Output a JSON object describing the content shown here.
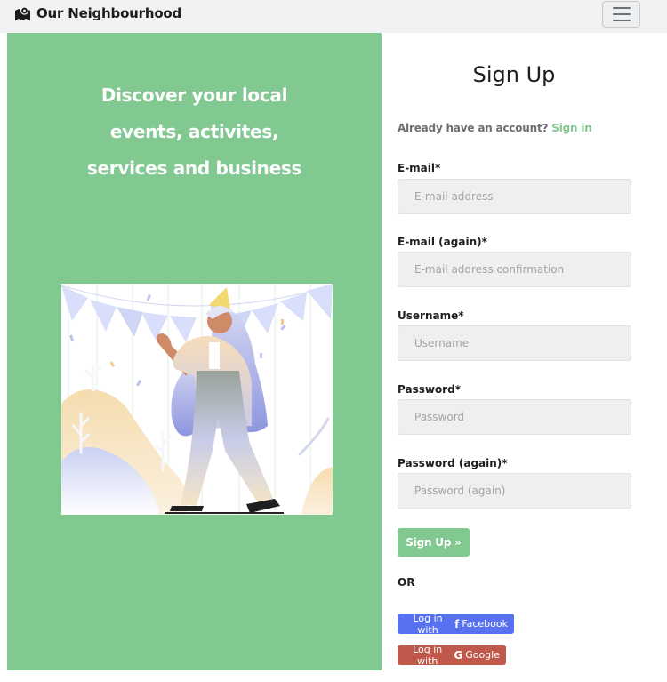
{
  "navbar": {
    "brand_icon": "map-pin-icon",
    "brand_text": "Our Neighbourhood",
    "toggler_icon": "hamburger-menu-icon"
  },
  "hero": {
    "line1": "Discover your local",
    "line2": "events, activites,",
    "line3": "services and business"
  },
  "illustration": {
    "description_icon": "party-celebration-illustration"
  },
  "form": {
    "title": "Sign Up",
    "have_account_text": "Already have an account?",
    "sign_in_link": "Sign in",
    "email_label": "E-mail*",
    "email_placeholder": "E-mail address",
    "email2_label": "E-mail (again)*",
    "email2_placeholder": "E-mail address confirmation",
    "username_label": "Username*",
    "username_placeholder": "Username",
    "password_label": "Password*",
    "password_placeholder": "Password",
    "password2_label": "Password (again)*",
    "password2_placeholder": "Password (again)",
    "submit_label": "Sign Up »",
    "or_text": "OR"
  },
  "social": {
    "facebook_prefix": "Log in with",
    "facebook_glyph": "f",
    "facebook_name": "Facebook",
    "google_prefix": "Log in with",
    "google_glyph": "G",
    "google_name": "Google"
  },
  "colors": {
    "accent_green": "#82c891",
    "facebook_blue": "#5872ef",
    "google_red": "#c0584b",
    "navbar_bg": "#f1f2f4"
  }
}
